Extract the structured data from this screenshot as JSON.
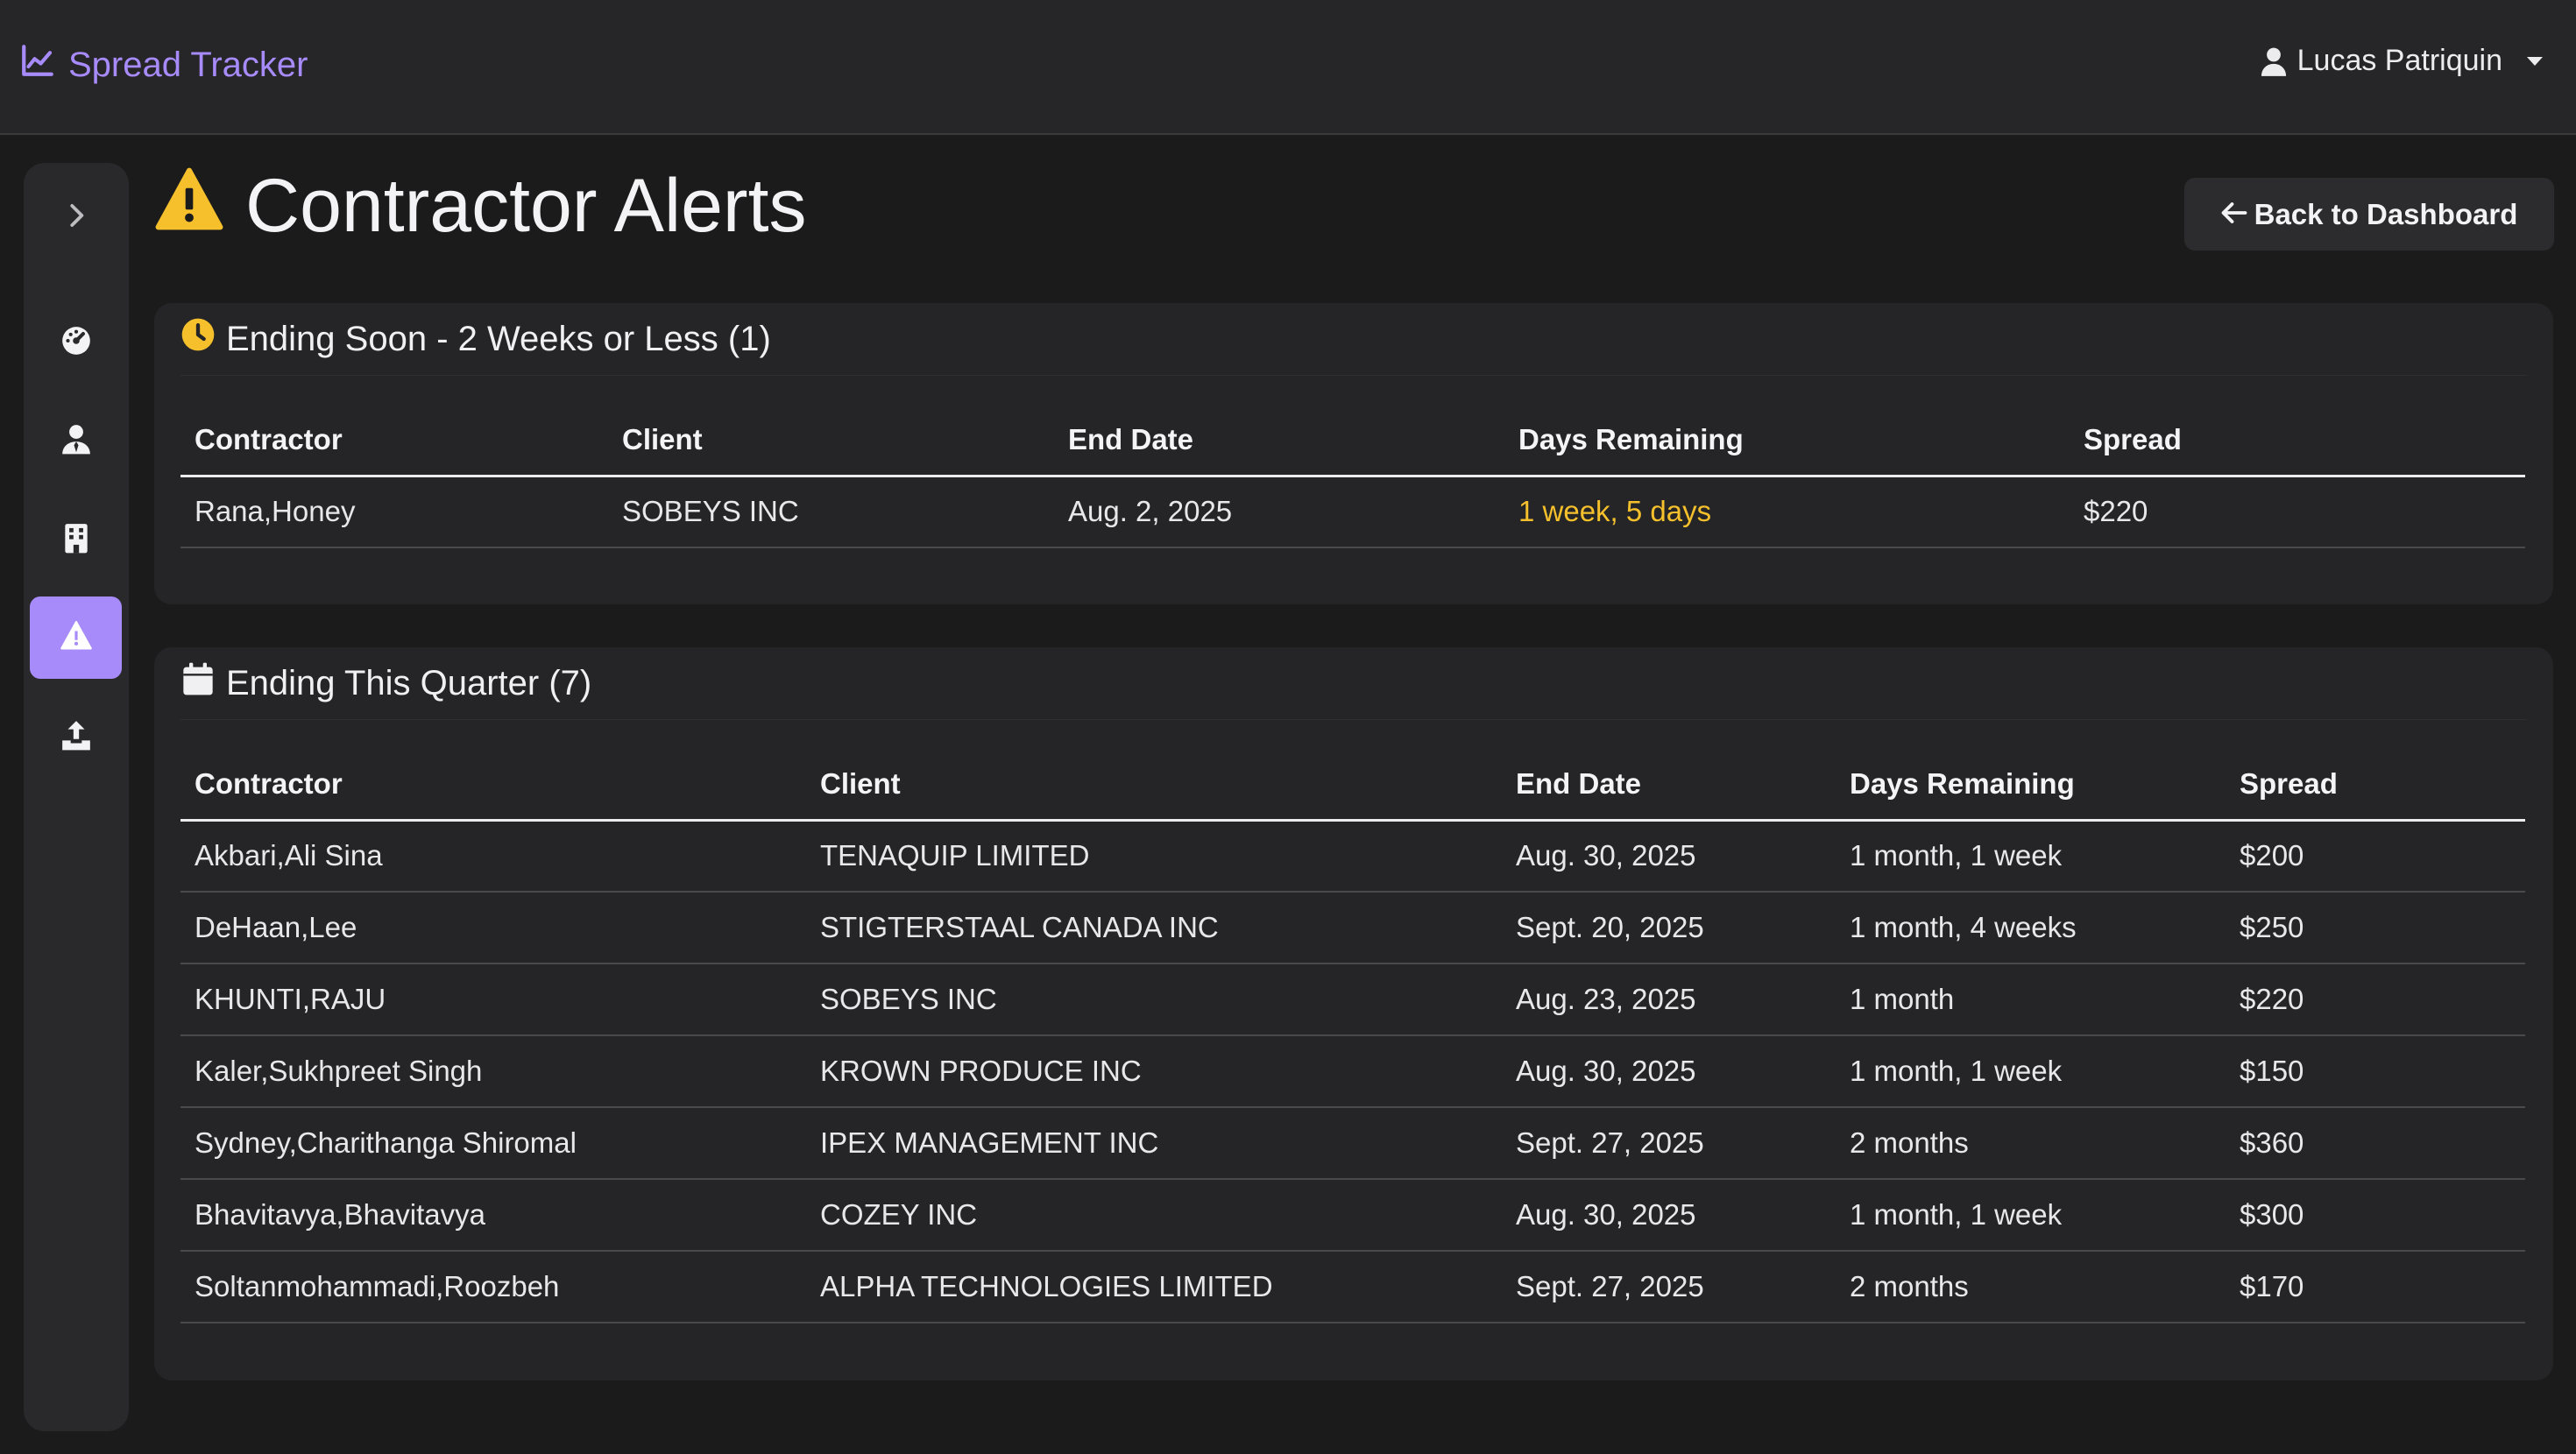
{
  "app": {
    "brand": "Spread Tracker",
    "user_name": "Lucas Patriquin"
  },
  "sidebar": {
    "items": [
      {
        "name": "expand",
        "icon": "chevron-right-icon",
        "active": false
      },
      {
        "name": "dashboard",
        "icon": "gauge-icon",
        "active": false
      },
      {
        "name": "contractors",
        "icon": "user-tie-icon",
        "active": false
      },
      {
        "name": "clients",
        "icon": "building-icon",
        "active": false
      },
      {
        "name": "alerts",
        "icon": "warning-triangle-icon",
        "active": true
      },
      {
        "name": "upload",
        "icon": "upload-icon",
        "active": false
      }
    ]
  },
  "page": {
    "title": "Contractor Alerts",
    "back_label": "Back to Dashboard"
  },
  "colors": {
    "accent": "#a78bfa",
    "warning": "#f5c02b",
    "background": "#1b1b1c",
    "card": "#252527"
  },
  "ending_soon": {
    "title": "Ending Soon - 2 Weeks or Less (1)",
    "icon": "clock-icon",
    "columns": [
      "Contractor",
      "Client",
      "End Date",
      "Days Remaining",
      "Spread"
    ],
    "rows": [
      [
        "Rana,Honey",
        "SOBEYS INC",
        "Aug. 2, 2025",
        "1 week, 5 days",
        "$220"
      ]
    ]
  },
  "ending_quarter": {
    "title": "Ending This Quarter (7)",
    "icon": "calendar-icon",
    "columns": [
      "Contractor",
      "Client",
      "End Date",
      "Days Remaining",
      "Spread"
    ],
    "rows": [
      [
        "Akbari,Ali Sina",
        "TENAQUIP LIMITED",
        "Aug. 30, 2025",
        "1 month, 1 week",
        "$200"
      ],
      [
        "DeHaan,Lee",
        "STIGTERSTAAL CANADA INC",
        "Sept. 20, 2025",
        "1 month, 4 weeks",
        "$250"
      ],
      [
        "KHUNTI,RAJU",
        "SOBEYS INC",
        "Aug. 23, 2025",
        "1 month",
        "$220"
      ],
      [
        "Kaler,Sukhpreet Singh",
        "KROWN PRODUCE INC",
        "Aug. 30, 2025",
        "1 month, 1 week",
        "$150"
      ],
      [
        "Sydney,Charithanga Shiromal",
        "IPEX MANAGEMENT INC",
        "Sept. 27, 2025",
        "2 months",
        "$360"
      ],
      [
        "Bhavitavya,Bhavitavya",
        "COZEY INC",
        "Aug. 30, 2025",
        "1 month, 1 week",
        "$300"
      ],
      [
        "Soltanmohammadi,Roozbeh",
        "ALPHA TECHNOLOGIES LIMITED",
        "Sept. 27, 2025",
        "2 months",
        "$170"
      ]
    ]
  }
}
